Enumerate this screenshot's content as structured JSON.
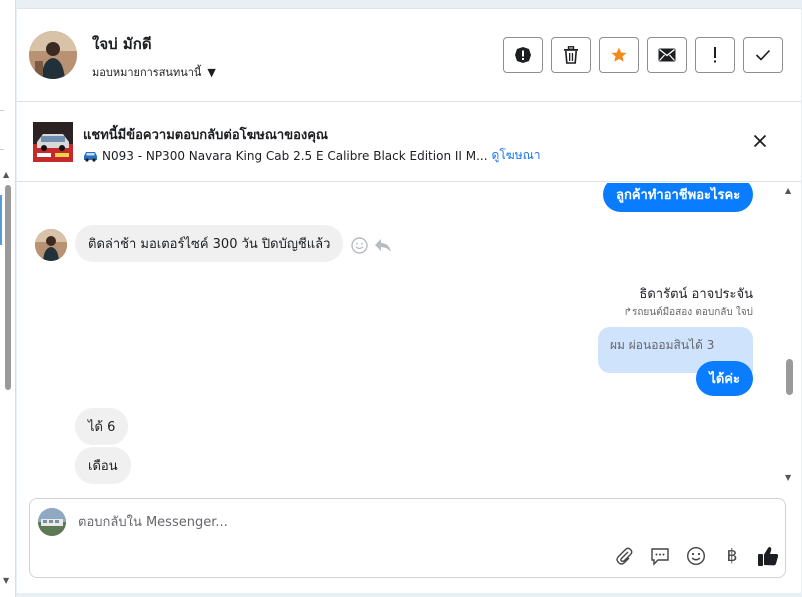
{
  "header": {
    "user_name": "ใจบ่ มักดี",
    "assign_label": "มอบหมายการสนทนานี้",
    "actions": [
      {
        "name": "spam-button",
        "icon": "alert-circle-icon"
      },
      {
        "name": "delete-button",
        "icon": "trash-icon"
      },
      {
        "name": "star-button",
        "icon": "star-icon"
      },
      {
        "name": "mark-unread-button",
        "icon": "envelope-icon"
      },
      {
        "name": "follow-up-button",
        "icon": "exclamation-icon"
      },
      {
        "name": "mark-done-button",
        "icon": "check-icon"
      }
    ]
  },
  "ad": {
    "title": "แชทนี้มีข้อความตอบกลับต่อโฆษณาของคุณ",
    "listing": "N093 - NP300 Navara King Cab 2.5 E Calibre Black Edition II M...",
    "link_label": "ดูโฆษณา"
  },
  "messages": {
    "top_out": "ลูกค้าทำอาชีพอะไรคะ",
    "in_1": "ติดล่าช้า มอเตอร์ไซค์ 300 วัน ปิดบัญชีแล้ว",
    "sender_name": "ธิดารัตน์ อาจประจัน",
    "reply_note": "รถยนต์มือสอง ตอบกลับ ใจบ่",
    "quoted": "ผม ผ่อนออมสินได้ 3",
    "out_2": "ได้ค่ะ",
    "in_2": "ได้ 6",
    "in_3": "เดือน"
  },
  "composer": {
    "placeholder": "ตอบกลับใน Messenger...",
    "baht_symbol": "฿"
  },
  "colors": {
    "accent": "#0a7cff",
    "star": "#f28a1e",
    "link": "#1877f2"
  }
}
